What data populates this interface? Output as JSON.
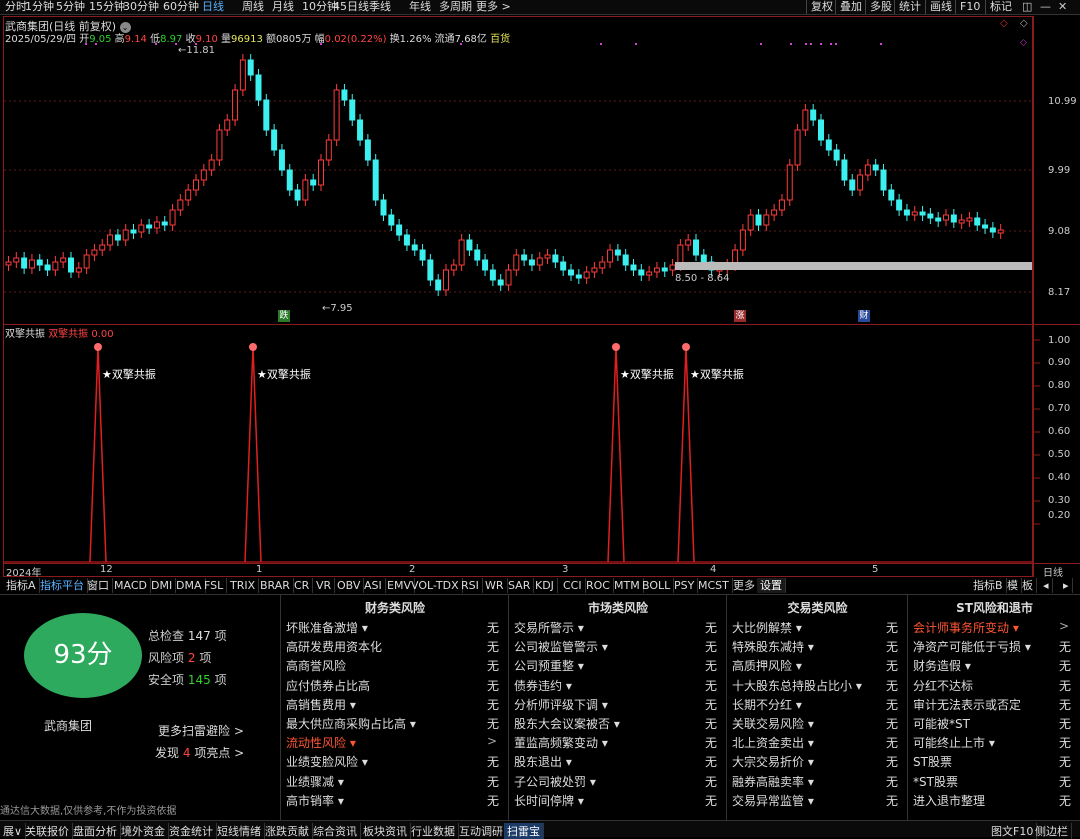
{
  "topbar": {
    "items": [
      "分时",
      "1分钟",
      "5分钟",
      "15分钟",
      "30分钟",
      "60分钟",
      "日线",
      "周线",
      "月线",
      "10分钟",
      "45日线",
      "季线",
      "年线",
      "多周期",
      "更多 >"
    ],
    "active": "日线",
    "right": [
      "复权",
      "叠加",
      "多股",
      "统计",
      "画线",
      "F10",
      "标记"
    ]
  },
  "header": {
    "title": "武商集团(日线 前复权)",
    "date": "2025/05/29/四",
    "open_lbl": "开",
    "open": "9.05",
    "high_lbl": "高",
    "high": "9.14",
    "low_lbl": "低",
    "low": "8.97",
    "close_lbl": "收",
    "close": "9.10",
    "vol_lbl": "量",
    "vol": "96913",
    "amt_lbl": "额",
    "amt": "0805万",
    "chg_lbl": "幅",
    "chg": "0.02(0.22%)",
    "turn": "换1.26%",
    "float": "流通7.68亿",
    "tag": "百货"
  },
  "price_axis": [
    "10.99",
    "9.99",
    "9.08",
    "8.17"
  ],
  "annotations": {
    "high": "11.81",
    "low": "7.95",
    "range": "8.50 - 8.64",
    "badge1": "跌",
    "badge2": "涨",
    "badge3": "财"
  },
  "indicator": {
    "name": "双擎共振",
    "label": "双擎共振",
    "value": "0.00",
    "signal_text": "★双擎共振",
    "axis": [
      "1.00",
      "0.90",
      "0.80",
      "0.70",
      "0.60",
      "0.50",
      "0.40",
      "0.30",
      "0.20"
    ]
  },
  "time_axis": {
    "labels": [
      "2024年",
      "12",
      "1",
      "2",
      "3",
      "4",
      "5"
    ],
    "right": "日线"
  },
  "tabs": [
    "指标A",
    "指标平台",
    "窗口",
    "MACD",
    "DMI",
    "DMA",
    "FSL",
    "TRIX",
    "BRAR",
    "CR",
    "VR",
    "OBV",
    "ASI",
    "EMV",
    "VOL-TDX",
    "RSI",
    "WR",
    "SAR",
    "KDJ",
    "CCI",
    "ROC",
    "MTM",
    "BOLL",
    "PSY",
    "MCST",
    "更多",
    "设置"
  ],
  "tabs_right": [
    "指标B",
    "模",
    "板"
  ],
  "score": {
    "value": "93分",
    "name": "武商集团",
    "total_lbl": "总检查",
    "total": "147",
    "risk_lbl": "风险项",
    "risk": "2",
    "safe_lbl": "安全项",
    "safe": "145",
    "unit": "项",
    "more": "更多扫雷避险 >",
    "found_pre": "发现",
    "found": "4",
    "found_post": "项亮点 >",
    "disclaimer": "通达信大数据,仅供参考,不作为投资依据"
  },
  "columns": [
    {
      "title": "财务类风险",
      "rows": [
        [
          "坏账准备激增 ▾",
          "无"
        ],
        [
          "高研发费用资本化",
          "无"
        ],
        [
          "高商誉风险",
          "无"
        ],
        [
          "应付债券占比高",
          "无"
        ],
        [
          "高销售费用 ▾",
          "无"
        ],
        [
          "最大供应商采购占比高 ▾",
          "无"
        ],
        [
          "流动性风险 ▾",
          ">"
        ],
        [
          "业绩变脸风险 ▾",
          "无"
        ],
        [
          "业绩骤减 ▾",
          "无"
        ],
        [
          "高市销率 ▾",
          "无"
        ]
      ]
    },
    {
      "title": "市场类风险",
      "rows": [
        [
          "交易所警示 ▾",
          "无"
        ],
        [
          "公司被监管警示 ▾",
          "无"
        ],
        [
          "公司预重整 ▾",
          "无"
        ],
        [
          "债券违约 ▾",
          "无"
        ],
        [
          "分析师评级下调 ▾",
          "无"
        ],
        [
          "股东大会议案被否 ▾",
          "无"
        ],
        [
          "董监高频繁变动 ▾",
          "无"
        ],
        [
          "股东退出 ▾",
          "无"
        ],
        [
          "子公司被处罚 ▾",
          "无"
        ],
        [
          "长时间停牌 ▾",
          "无"
        ]
      ]
    },
    {
      "title": "交易类风险",
      "rows": [
        [
          "大比例解禁 ▾",
          "无"
        ],
        [
          "特殊股东减持 ▾",
          "无"
        ],
        [
          "高质押风险 ▾",
          "无"
        ],
        [
          "十大股东总持股占比小 ▾",
          "无"
        ],
        [
          "长期不分红 ▾",
          "无"
        ],
        [
          "关联交易风险 ▾",
          "无"
        ],
        [
          "北上资金卖出 ▾",
          "无"
        ],
        [
          "大宗交易折价 ▾",
          "无"
        ],
        [
          "融券高融卖率 ▾",
          "无"
        ],
        [
          "交易异常监管 ▾",
          "无"
        ]
      ]
    },
    {
      "title": "ST风险和退市",
      "rows": [
        [
          "会计师事务所变动 ▾",
          ">"
        ],
        [
          "净资产可能低于亏损 ▾",
          "无"
        ],
        [
          "财务造假 ▾",
          "无"
        ],
        [
          "分红不达标",
          "无"
        ],
        [
          "审计无法表示或否定",
          "无"
        ],
        [
          "可能被*ST",
          "无"
        ],
        [
          "可能终止上市 ▾",
          "无"
        ],
        [
          "ST股票",
          "无"
        ],
        [
          "*ST股票",
          "无"
        ],
        [
          "进入退市整理",
          "无"
        ]
      ]
    }
  ],
  "bottombar": [
    "展∨",
    "关联报价",
    "盘面分析",
    "境外资金",
    "资金统计",
    "短线情绪",
    "涨跌贡献",
    "综合资讯",
    "板块资讯",
    "行业数据",
    "互动调研",
    "扫雷宝"
  ],
  "bottombar_right": [
    "图文F10",
    "侧边栏"
  ]
}
